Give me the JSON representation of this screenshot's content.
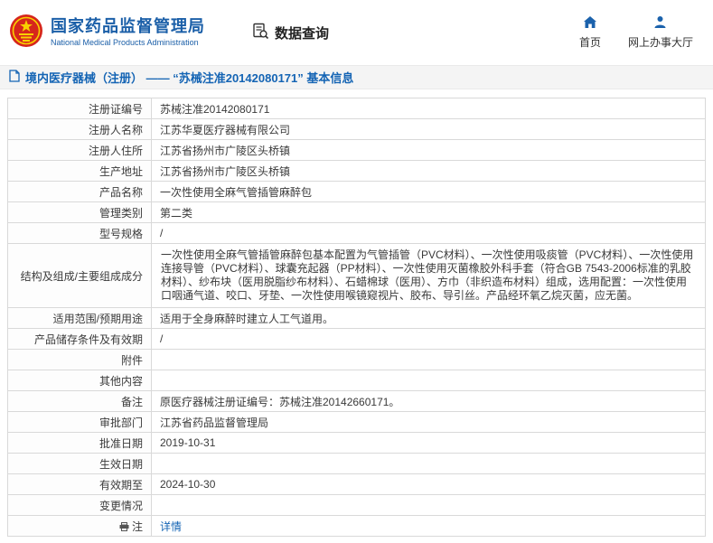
{
  "header": {
    "title": "国家药品监督管理局",
    "subtitle": "National Medical Products Administration",
    "query_label": "数据查询",
    "nav": [
      {
        "label": "首页"
      },
      {
        "label": "网上办事大厅"
      }
    ]
  },
  "breadcrumb": {
    "text": "境内医疗器械（注册） —— “苏械注准20142080171” 基本信息"
  },
  "colors": {
    "brand_blue": "#1b5fa8",
    "link_blue": "#1464b4",
    "emblem_red": "#d6261c"
  },
  "table": {
    "rows": [
      {
        "label": "注册证编号",
        "value": "苏械注准20142080171"
      },
      {
        "label": "注册人名称",
        "value": "江苏华夏医疗器械有限公司"
      },
      {
        "label": "注册人住所",
        "value": "江苏省扬州市广陵区头桥镇"
      },
      {
        "label": "生产地址",
        "value": "江苏省扬州市广陵区头桥镇"
      },
      {
        "label": "产品名称",
        "value": "一次性使用全麻气管插管麻醉包"
      },
      {
        "label": "管理类别",
        "value": "第二类"
      },
      {
        "label": "型号规格",
        "value": "/"
      },
      {
        "label": "结构及组成/主要组成成分",
        "value": "一次性使用全麻气管插管麻醉包基本配置为气管插管（PVC材料）、一次性使用吸痰管（PVC材料）、一次性使用连接导管（PVC材料）、球囊充起器（PP材料）、一次性使用灭菌橡胶外科手套（符合GB 7543-2006标准的乳胶材料）、纱布块（医用脱脂纱布材料）、石蜡棉球（医用）、方巾（非织造布材料）组成，选用配置：一次性使用口咽通气道、咬口、牙垫、一次性使用喉镜窥视片、胶布、导引丝。产品经环氧乙烷灭菌，应无菌。",
        "tall": true
      },
      {
        "label": "适用范围/预期用途",
        "value": "适用于全身麻醉时建立人工气道用。"
      },
      {
        "label": "产品储存条件及有效期",
        "value": "/"
      },
      {
        "label": "附件",
        "value": ""
      },
      {
        "label": "其他内容",
        "value": ""
      },
      {
        "label": "备注",
        "value": "原医疗器械注册证编号：苏械注准20142660171。"
      },
      {
        "label": "审批部门",
        "value": "江苏省药品监督管理局"
      },
      {
        "label": "批准日期",
        "value": "2019-10-31"
      },
      {
        "label": "生效日期",
        "value": ""
      },
      {
        "label": "有效期至",
        "value": "2024-10-30"
      },
      {
        "label": "变更情况",
        "value": ""
      },
      {
        "label": "注",
        "value": "详情",
        "link": true,
        "label_icon": "print-icon"
      }
    ]
  }
}
